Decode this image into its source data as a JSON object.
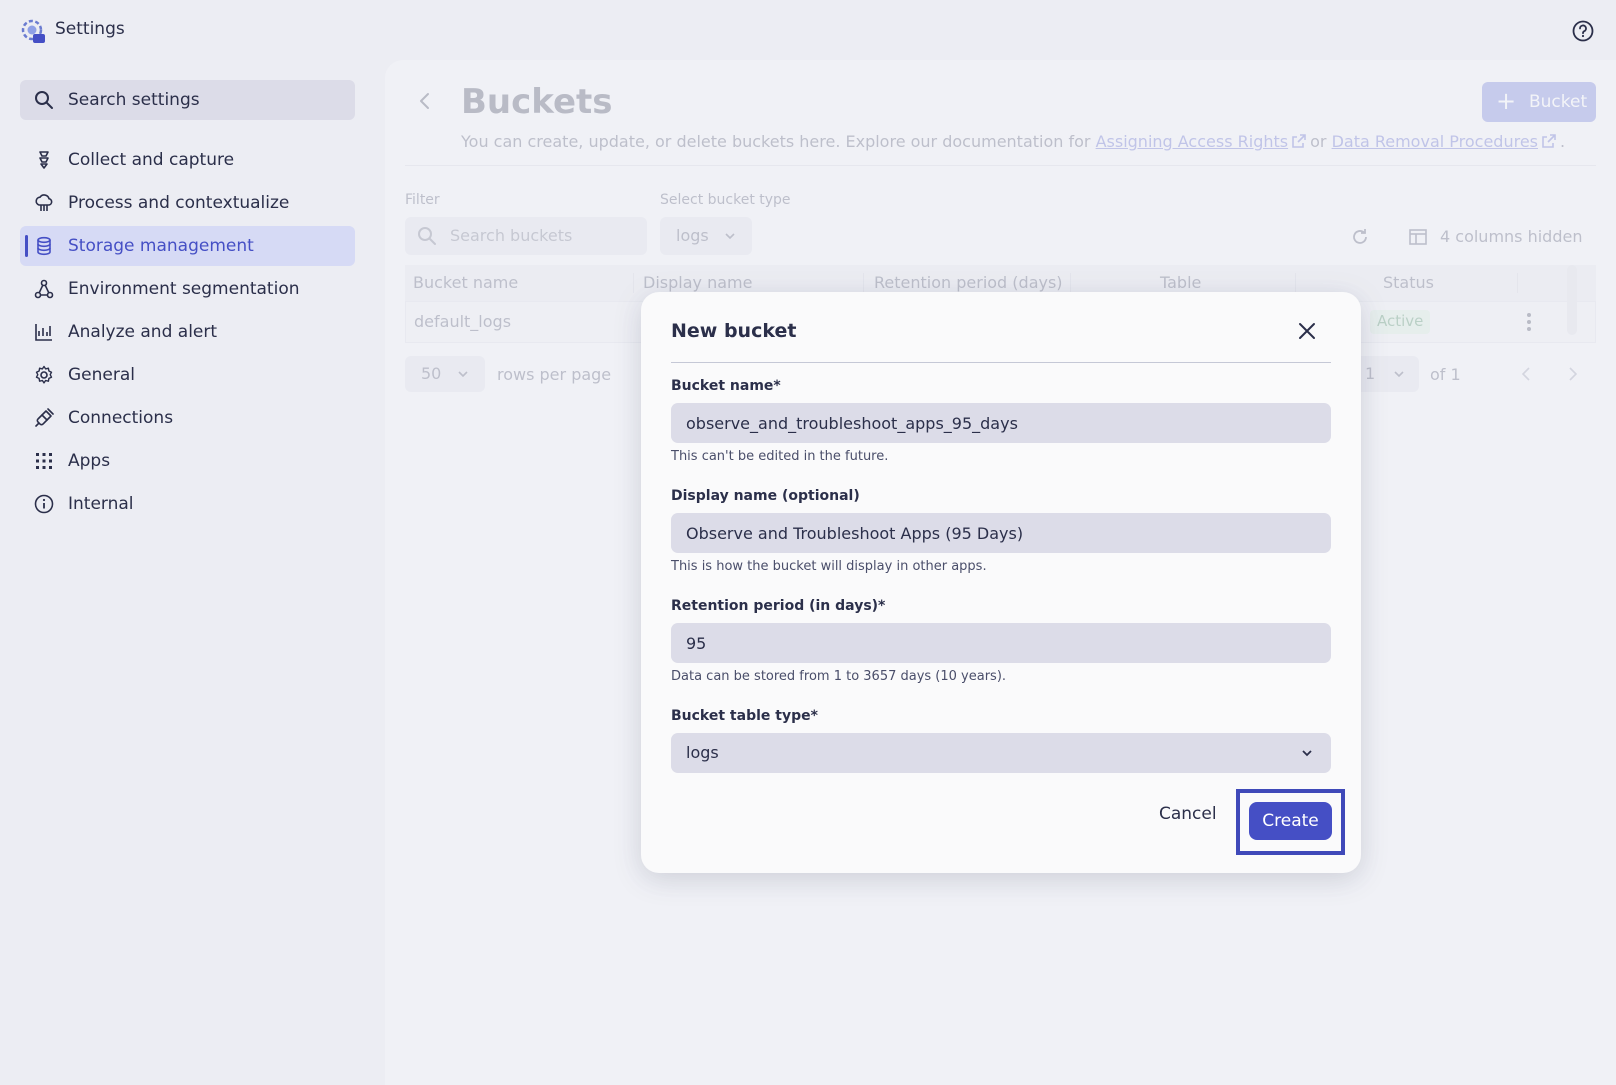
{
  "app": {
    "title": "Settings"
  },
  "sidebar": {
    "search_label": "Search settings",
    "items": [
      {
        "label": "Collect and capture",
        "icon": "collect-icon"
      },
      {
        "label": "Process and contextualize",
        "icon": "cloud-process-icon"
      },
      {
        "label": "Storage management",
        "icon": "database-icon",
        "active": true
      },
      {
        "label": "Environment segmentation",
        "icon": "segmentation-icon"
      },
      {
        "label": "Analyze and alert",
        "icon": "chart-icon"
      },
      {
        "label": "General",
        "icon": "gear-icon"
      },
      {
        "label": "Connections",
        "icon": "plug-icon"
      },
      {
        "label": "Apps",
        "icon": "apps-grid-icon"
      },
      {
        "label": "Internal",
        "icon": "info-icon"
      }
    ]
  },
  "page": {
    "title": "Buckets",
    "add_button": "Bucket",
    "description_prefix": "You can create, update, or delete buckets here. Explore our documentation for ",
    "link_access": "Assigning Access Rights",
    "description_or": "or",
    "link_removal": "Data Removal Procedures",
    "description_suffix": "."
  },
  "filters": {
    "filter_label": "Filter",
    "search_placeholder": "Search buckets",
    "type_label": "Select bucket type",
    "type_value": "logs",
    "columns_hidden": "4 columns hidden"
  },
  "table": {
    "columns": [
      "Bucket name",
      "Display name",
      "Retention period (days)",
      "Table",
      "Status"
    ],
    "rows": [
      {
        "bucket_name": "default_logs",
        "status": "Active"
      }
    ]
  },
  "pagination": {
    "rows_per_page": "50",
    "rows_label": "rows per page",
    "page": "1",
    "of_label": "of 1"
  },
  "modal": {
    "title": "New bucket",
    "bucket_name_label": "Bucket name*",
    "bucket_name_value": "observe_and_troubleshoot_apps_95_days",
    "bucket_name_hint": "This can't be edited in the future.",
    "display_name_label": "Display name (optional)",
    "display_name_value": "Observe and Troubleshoot Apps (95 Days)",
    "display_name_hint": "This is how the bucket will display in other apps.",
    "retention_label": "Retention period (in days)*",
    "retention_value": "95",
    "retention_hint": "Data can be stored from 1 to 3657 days (10 years).",
    "table_type_label": "Bucket table type*",
    "table_type_value": "logs",
    "cancel": "Cancel",
    "create": "Create"
  },
  "colors": {
    "accent": "#454fc5",
    "background": "#ecedf3",
    "panel": "#f3f3f7",
    "input": "#dcdce8",
    "active_nav": "#d6daf5"
  }
}
